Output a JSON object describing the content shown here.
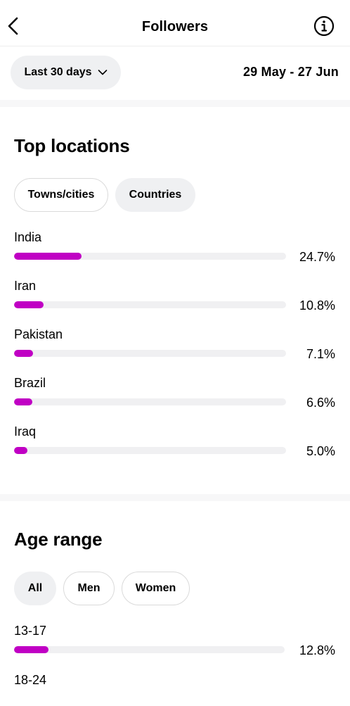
{
  "header": {
    "title": "Followers"
  },
  "filter": {
    "range_label": "Last 30 days",
    "date_range": "29 May - 27 Jun"
  },
  "locations": {
    "title": "Top locations",
    "tabs": [
      {
        "label": "Towns/cities"
      },
      {
        "label": "Countries"
      }
    ],
    "rows": [
      {
        "label": "India",
        "percent": "24.7%",
        "value": 24.7
      },
      {
        "label": "Iran",
        "percent": "10.8%",
        "value": 10.8
      },
      {
        "label": "Pakistan",
        "percent": "7.1%",
        "value": 7.1
      },
      {
        "label": "Brazil",
        "percent": "6.6%",
        "value": 6.6
      },
      {
        "label": "Iraq",
        "percent": "5.0%",
        "value": 5.0
      }
    ]
  },
  "age": {
    "title": "Age range",
    "tabs": [
      {
        "label": "All"
      },
      {
        "label": "Men"
      },
      {
        "label": "Women"
      }
    ],
    "rows": [
      {
        "label": "13-17",
        "percent": "12.8%",
        "value": 12.8
      },
      {
        "label": "18-24"
      }
    ]
  },
  "colors": {
    "bar": "#c000c4",
    "track": "#f0f0f2",
    "chip": "#eff0f2"
  }
}
